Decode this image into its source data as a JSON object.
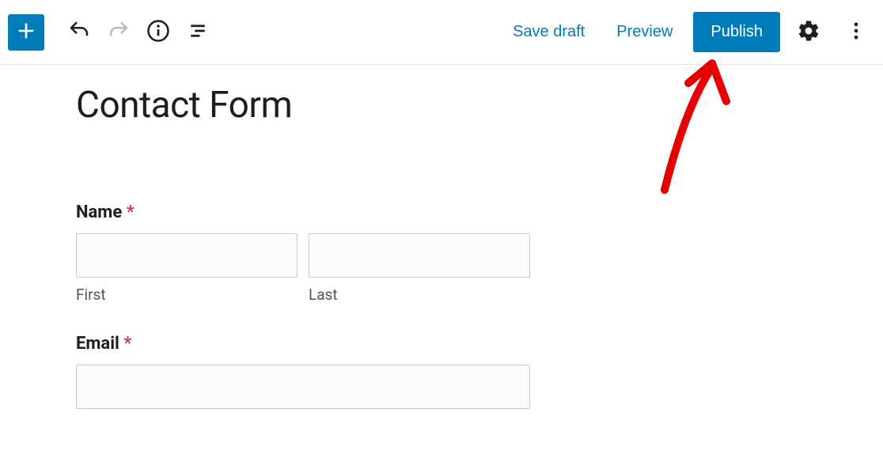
{
  "toolbar": {
    "save_draft_label": "Save draft",
    "preview_label": "Preview",
    "publish_label": "Publish"
  },
  "page": {
    "title": "Contact Form"
  },
  "form": {
    "name": {
      "label": "Name",
      "required_mark": "*",
      "first_sublabel": "First",
      "last_sublabel": "Last"
    },
    "email": {
      "label": "Email",
      "required_mark": "*"
    }
  }
}
